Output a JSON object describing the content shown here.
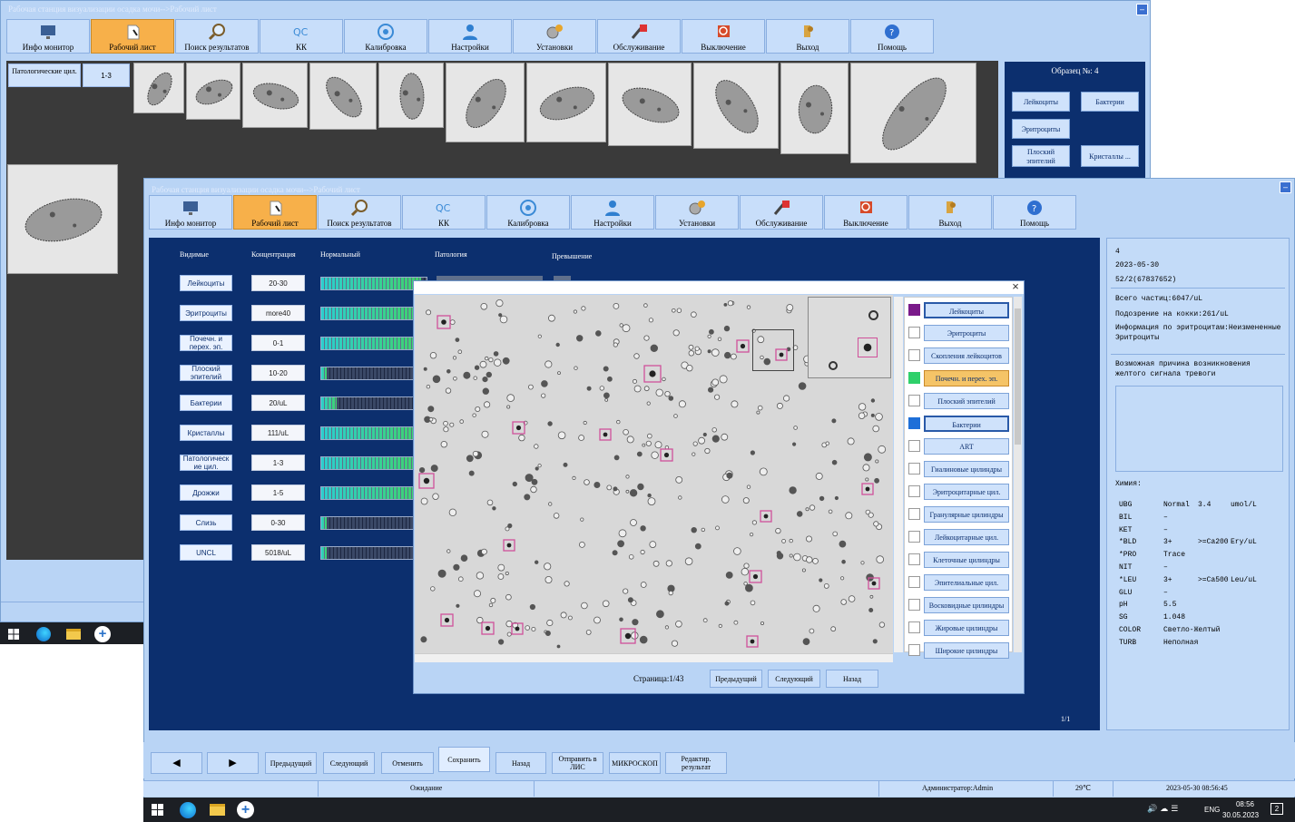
{
  "back_window": {
    "title": "Рабочая станция визуализации осадка мочи-->Рабочий лист",
    "toolbar": [
      "Инфо монитор",
      "Рабочий лист",
      "Поиск результатов",
      "КК",
      "Калибровка",
      "Настройки",
      "Установки",
      "Обслуживание",
      "Выключение",
      "Выход",
      "Помощь"
    ],
    "category_label": "Патологические цил.",
    "category_value": "1-3",
    "sample_title": "Образец №: 4",
    "side_buttons": [
      "Лейкоциты",
      "Бактерии",
      "Эритроциты",
      "Плоский эпителий",
      "Кристаллы ..."
    ]
  },
  "front_window": {
    "title": "Рабочая станция визуализации осадка мочи-->Рабочий лист",
    "toolbar": [
      "Инфо монитор",
      "Рабочий лист",
      "Поиск результатов",
      "КК",
      "Калибровка",
      "Настройки",
      "Установки",
      "Обслуживание",
      "Выключение",
      "Выход",
      "Помощь"
    ],
    "headers": {
      "type": "Видимые",
      "conc": "Концентрация",
      "normal": "Нормальный",
      "patho": "Патология",
      "excess": "Превышение"
    },
    "rows": [
      {
        "label": "Лейкоциты",
        "conc": "20-30",
        "level": 0.95
      },
      {
        "label": "Эритроциты",
        "conc": "more40",
        "level": 0.95
      },
      {
        "label": "Почечн. и перех. эп.",
        "conc": "0-1",
        "level": 0.95
      },
      {
        "label": "Плоский эпителий",
        "conc": "10-20",
        "level": 0.05
      },
      {
        "label": "Бактерии",
        "conc": "20/uL",
        "level": 0.15
      },
      {
        "label": "Кристаллы",
        "conc": "111/uL",
        "level": 0.95
      },
      {
        "label": "Патологическ ие цил.",
        "conc": "1-3",
        "level": 0.95
      },
      {
        "label": "Дрожжи",
        "conc": "1-5",
        "level": 0.95
      },
      {
        "label": "Слизь",
        "conc": "0-30",
        "level": 0.05
      },
      {
        "label": "UNCL",
        "conc": "5018/uL",
        "level": 0.05
      }
    ],
    "page_counter": "1/1",
    "info": {
      "sample_no": "4",
      "date": "2023-05-30",
      "id": "52/2(67837652)",
      "total": "Всего частиц:6047/uL",
      "cocci": "Подозрение на кокки:261/uL",
      "rbc_info": "Информация по эритроцитам:Неизмененные Эритроциты",
      "reason": "Возможная причина возникновения желтого сигнала тревоги",
      "chem_title": "Химия:",
      "chem": [
        {
          "name": "UBG",
          "val": "Normal",
          "num": "3.4",
          "unit": "umol/L"
        },
        {
          "name": "BIL",
          "val": "–",
          "num": "",
          "unit": ""
        },
        {
          "name": "KET",
          "val": "–",
          "num": "",
          "unit": ""
        },
        {
          "name": "*BLD",
          "val": "3+",
          "num": ">=Ca200",
          "unit": "Ery/uL"
        },
        {
          "name": "*PRO",
          "val": "Trace",
          "num": "",
          "unit": ""
        },
        {
          "name": "NIT",
          "val": "–",
          "num": "",
          "unit": ""
        },
        {
          "name": "*LEU",
          "val": "3+",
          "num": ">=Ca500",
          "unit": "Leu/uL"
        },
        {
          "name": "GLU",
          "val": "–",
          "num": "",
          "unit": ""
        },
        {
          "name": "pH",
          "val": "5.5",
          "num": "",
          "unit": ""
        },
        {
          "name": "SG",
          "val": "1.048",
          "num": "",
          "unit": ""
        },
        {
          "name": "COLOR",
          "val": "Светло-Желтый",
          "num": "",
          "unit": ""
        },
        {
          "name": "TURB",
          "val": "Неполная",
          "num": "",
          "unit": ""
        }
      ]
    },
    "bottom_buttons": [
      "Предыдущий",
      "Следующий",
      "Отменить",
      "Сохранить",
      "Назад",
      "Отправить в ЛИС",
      "МИКРОСКОП",
      "Редактир. результат"
    ],
    "status": {
      "state": "Ожидание",
      "user": "Администратор:Admin",
      "temp": "29℃",
      "datetime": "2023-05-30 08:56:45"
    }
  },
  "dialog": {
    "close": "×",
    "page": "Страница:1/43",
    "buttons": [
      "Предыдущий",
      "Следующий",
      "Назад"
    ],
    "categories": [
      {
        "label": "Лейкоциты",
        "color": "#7a1a8a",
        "selected": true
      },
      {
        "label": "Эритроциты",
        "color": "",
        "selected": false
      },
      {
        "label": "Скопления лейкоцитов",
        "color": "",
        "selected": false
      },
      {
        "label": "Почечн. и перех. эп.",
        "color": "#2fd06a",
        "selected": true,
        "highlight": true
      },
      {
        "label": "Плоский эпителий",
        "color": "",
        "selected": false
      },
      {
        "label": "Бактерии",
        "color": "#1e6fd8",
        "selected": true
      },
      {
        "label": "ART",
        "color": "",
        "selected": false
      },
      {
        "label": "Гиалиновые цилиндры",
        "color": "",
        "selected": false
      },
      {
        "label": "Эритроцитарные цил.",
        "color": "",
        "selected": false
      },
      {
        "label": "Гранулярные цилиндры",
        "color": "",
        "selected": false
      },
      {
        "label": "Лейкоцитарные цил.",
        "color": "",
        "selected": false
      },
      {
        "label": "Клеточные цилиндры",
        "color": "",
        "selected": false
      },
      {
        "label": "Эпителиальные цил.",
        "color": "",
        "selected": false
      },
      {
        "label": "Восковидные цилиндры",
        "color": "",
        "selected": false
      },
      {
        "label": "Жировые цилиндры",
        "color": "",
        "selected": false
      },
      {
        "label": "Широкие цилиндры",
        "color": "",
        "selected": false
      }
    ]
  },
  "taskbar": {
    "lang": "ENG",
    "time": "08:56",
    "date": "30.05.2023",
    "badge": "2"
  }
}
